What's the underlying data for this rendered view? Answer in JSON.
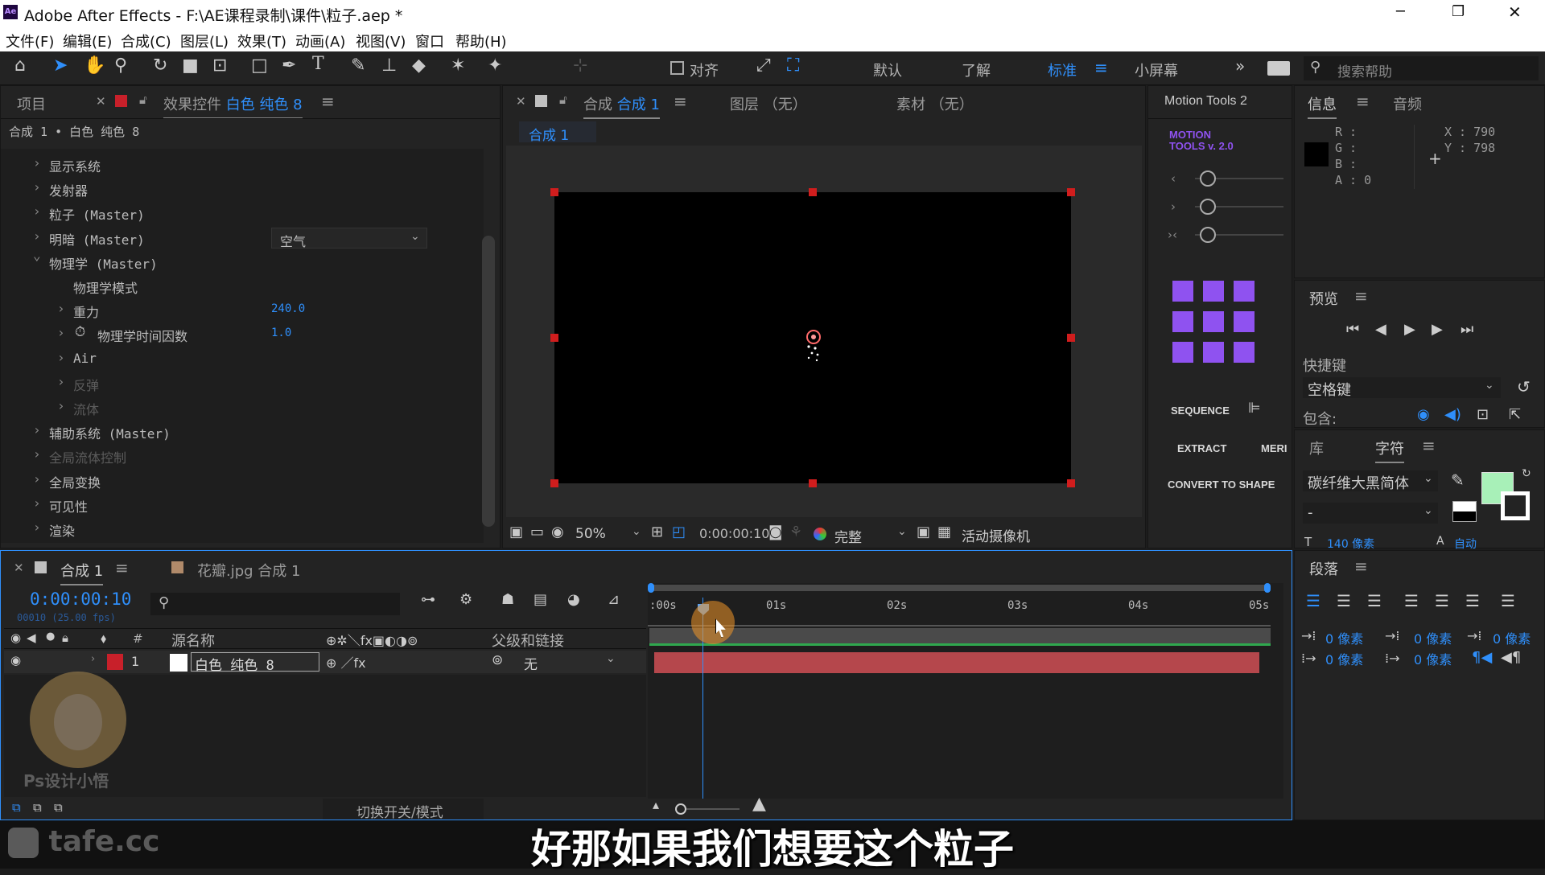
{
  "window": {
    "title": "Adobe After Effects - F:\\AE课程录制\\课件\\粒子.aep *",
    "minimize": "─",
    "maximize": "❐",
    "close": "✕"
  },
  "menu": [
    "文件(F)",
    "编辑(E)",
    "合成(C)",
    "图层(L)",
    "效果(T)",
    "动画(A)",
    "视图(V)",
    "窗口",
    "帮助(H)"
  ],
  "toolbar": {
    "snap_label": "对齐",
    "workspaces": [
      "默认",
      "了解",
      "标准",
      "小屏幕"
    ],
    "active_workspace": "标准",
    "search_placeholder": "搜索帮助"
  },
  "effects_panel": {
    "tab_project": "项目",
    "tab_effects_prefix": "效果控件",
    "tab_effects_layer": "白色 纯色 8",
    "breadcrumb": "合成 1 • 白色 纯色 8",
    "items": [
      {
        "label": "显示系统",
        "indent": 0,
        "expanded": false,
        "dim": false
      },
      {
        "label": "发射器",
        "indent": 0,
        "expanded": false,
        "dim": false
      },
      {
        "label": "粒子 (Master)",
        "indent": 0,
        "expanded": false,
        "dim": false
      },
      {
        "label": "明暗 (Master)",
        "indent": 0,
        "expanded": false,
        "dim": false
      },
      {
        "label": "物理学 (Master)",
        "indent": 0,
        "expanded": true,
        "dim": false
      },
      {
        "label": "物理学模式",
        "indent": 1,
        "expanded": null,
        "dim": false
      },
      {
        "label": "重力",
        "indent": 1,
        "expanded": false,
        "dim": false,
        "value": "240.0"
      },
      {
        "label": "物理学时间因数",
        "indent": 1,
        "expanded": false,
        "dim": false,
        "value": "1.0",
        "stopwatch": true
      },
      {
        "label": "Air",
        "indent": 1,
        "expanded": false,
        "dim": false
      },
      {
        "label": "反弹",
        "indent": 1,
        "expanded": false,
        "dim": true
      },
      {
        "label": "流体",
        "indent": 1,
        "expanded": false,
        "dim": true
      },
      {
        "label": "辅助系统 (Master)",
        "indent": 0,
        "expanded": false,
        "dim": false
      },
      {
        "label": "全局流体控制",
        "indent": 0,
        "expanded": false,
        "dim": true
      },
      {
        "label": "全局变换",
        "indent": 0,
        "expanded": false,
        "dim": false
      },
      {
        "label": "可见性",
        "indent": 0,
        "expanded": false,
        "dim": false
      },
      {
        "label": "渲染",
        "indent": 0,
        "expanded": false,
        "dim": false
      }
    ],
    "physics_mode_value": "空气"
  },
  "comp_panel": {
    "tab_comp_prefix": "合成",
    "tab_comp_name": "合成 1",
    "tab_layer": "图层 （无）",
    "tab_footage": "素材 （无）",
    "subtab": "合成 1",
    "zoom": "50%",
    "timecode": "0:00:00:10",
    "quality": "完整",
    "camera": "活动摄像机"
  },
  "motion_tools": {
    "tab": "Motion Tools 2",
    "logo_line1": "MOTION",
    "logo_line2": "TOOLS v. 2.0",
    "sequence": "SEQUENCE",
    "extract": "EXTRACT",
    "merge": "MERI",
    "convert": "CONVERT TO SHAPE"
  },
  "info_panel": {
    "tab_info": "信息",
    "tab_audio": "音频",
    "r": "R :",
    "g": "G :",
    "b": "B :",
    "a": "A : 0",
    "x": "X : 790",
    "y": "Y : 798"
  },
  "preview_panel": {
    "title": "预览",
    "shortcut_label": "快捷键",
    "shortcut_value": "空格键",
    "include_label": "包含:"
  },
  "char_panel": {
    "tab_library": "库",
    "tab_character": "字符",
    "font": "碳纤维大黑简体",
    "style": "-",
    "size_label": "140 像素",
    "tracking": "自动",
    "fill_color": "#a8f0b8"
  },
  "para_panel": {
    "title": "段落",
    "indent_left": "0 像素",
    "indent_first": "0 像素",
    "indent_right": "0 像素",
    "space_before": "0 像素",
    "space_after": "0 像素"
  },
  "timeline": {
    "tab_comp": "合成 1",
    "tab_other": "花瓣.jpg 合成 1",
    "timecode": "0:00:00:10",
    "frame_info": "00010 (25.00 fps)",
    "col_hash": "#",
    "col_source": "源名称",
    "col_parent": "父级和链接",
    "ruler": [
      ":00s",
      "01s",
      "02s",
      "03s",
      "04s",
      "05s"
    ],
    "layer": {
      "num": "1",
      "name": "白色 纯色 8",
      "parent": "无"
    },
    "toggle_label": "切换开关/模式"
  },
  "overlay": {
    "subtitle": "好那如果我们想要这个粒子",
    "watermark": "tafe.cc",
    "logo_text": "Ps设计小悟"
  }
}
